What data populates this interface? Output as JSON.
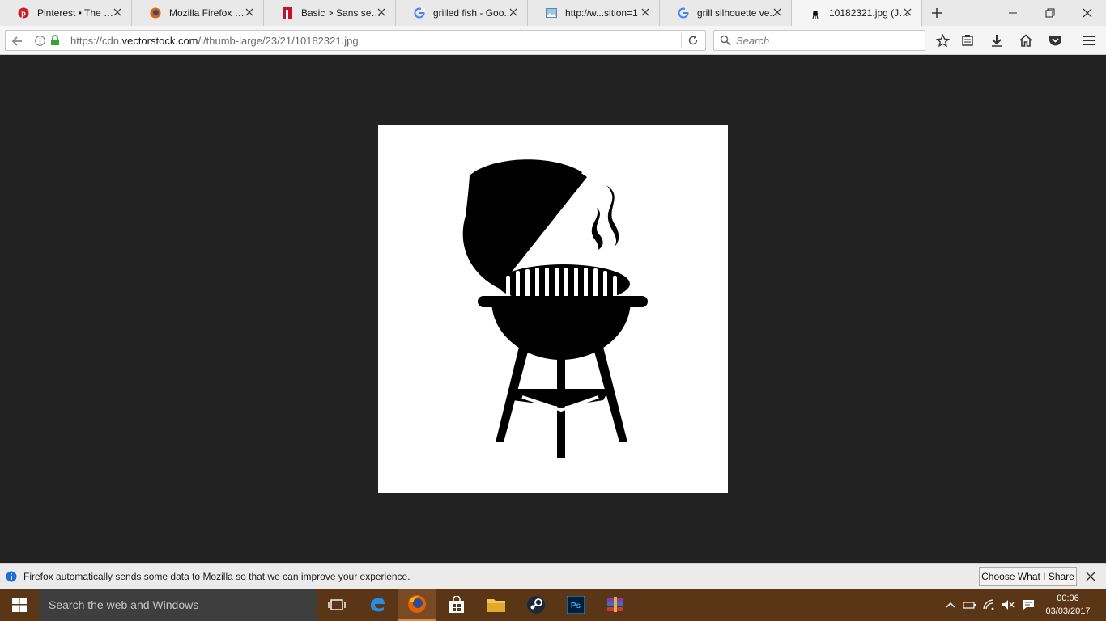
{
  "tabs": [
    {
      "label": "Pinterest • The w...",
      "icon": "pinterest-icon"
    },
    {
      "label": "Mozilla Firefox St...",
      "icon": "firefox-icon"
    },
    {
      "label": "Basic > Sans serif...",
      "icon": "fontsite-icon"
    },
    {
      "label": "grilled fish - Goo...",
      "icon": "google-icon"
    },
    {
      "label": "http://w...sition=1",
      "icon": "image-icon"
    },
    {
      "label": "grill silhouette ve...",
      "icon": "google-icon"
    },
    {
      "label": "10182321.jpg (JP...",
      "icon": "grill-favicon-icon",
      "selected": true
    }
  ],
  "navbar": {
    "url_prefix": "https://cdn.",
    "url_host": "vectorstock.com",
    "url_path": "/i/thumb-large/23/21/10182321.jpg",
    "search_placeholder": "Search"
  },
  "notification": {
    "text": "Firefox automatically sends some data to Mozilla so that we can improve your experience.",
    "button_label": "Choose What I Share"
  },
  "taskbar": {
    "search_text": "Search the web and Windows",
    "time": "00:06",
    "date": "03/03/2017"
  },
  "colors": {
    "content_bg": "#222222",
    "taskbar_bg": "#5a3516",
    "tabstrip_bg": "#e9e9e9"
  }
}
